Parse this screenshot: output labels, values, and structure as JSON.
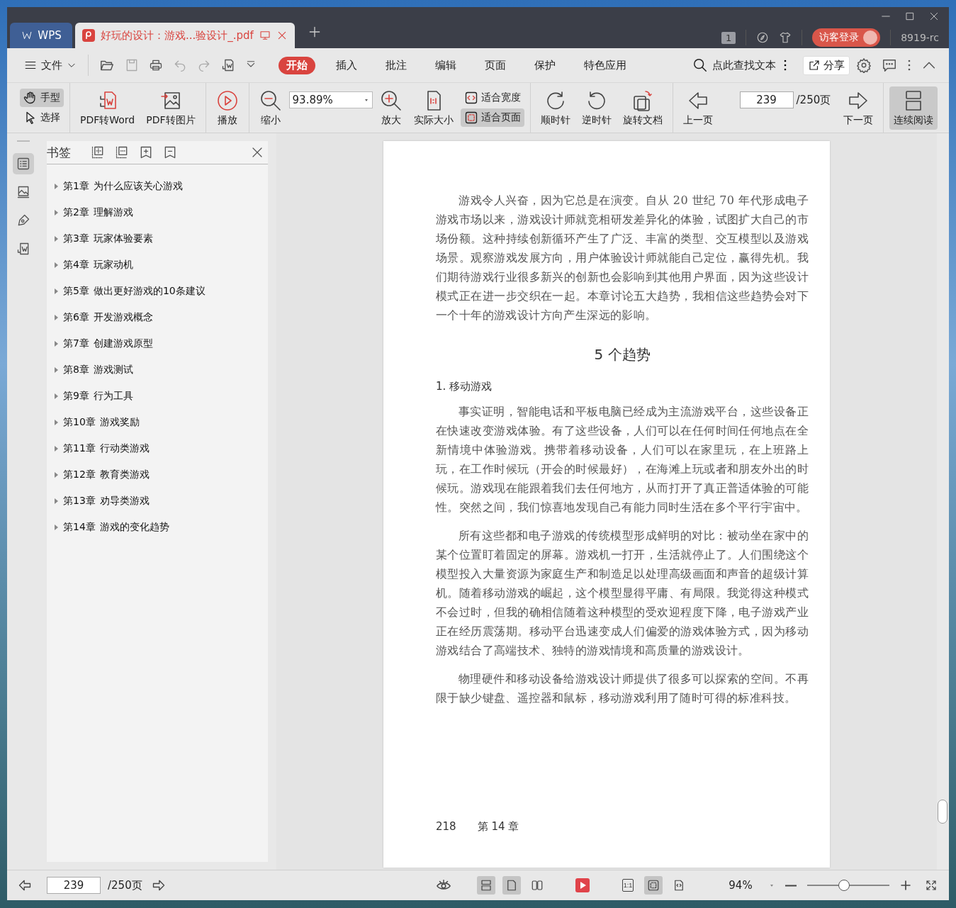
{
  "window": {
    "app_tab": "WPS",
    "doc_tab": "好玩的设计：游戏...验设计_.pdf",
    "badge": "1",
    "login": "访客登录",
    "user": "8919-rc"
  },
  "menu": {
    "file": "文件",
    "tabs": [
      {
        "label": "开始",
        "selected": true
      },
      {
        "label": "插入",
        "selected": false
      },
      {
        "label": "批注",
        "selected": false
      },
      {
        "label": "编辑",
        "selected": false
      },
      {
        "label": "页面",
        "selected": false
      },
      {
        "label": "保护",
        "selected": false
      },
      {
        "label": "特色应用",
        "selected": false
      }
    ],
    "search": "点此查找文本",
    "share": "分享"
  },
  "toolbar": {
    "hand": {
      "label": "手型",
      "selected": true
    },
    "select": {
      "label": "选择",
      "selected": false
    },
    "pdf_to_word": "PDF转Word",
    "pdf_to_image": "PDF转图片",
    "play": "播放",
    "zoom_out": "缩小",
    "zoom": "93.89%",
    "zoom_in": "放大",
    "actual_size": "实际大小",
    "fit_width": {
      "label": "适合宽度",
      "selected": false
    },
    "fit_page": {
      "label": "适合页面",
      "selected": true
    },
    "clockwise": "顺时针",
    "counterclockwise": "逆时针",
    "rotate": "旋转文档",
    "prev": "上一页",
    "page": "239",
    "page_total": "/250页",
    "next": "下一页",
    "continuous": {
      "label": "连续阅读",
      "selected": true
    }
  },
  "sidebar": {
    "title": "书签",
    "items": [
      {
        "number": "第1章",
        "title": "为什么应该关心游戏",
        "expanded": false
      },
      {
        "number": "第2章",
        "title": "理解游戏",
        "expanded": false
      },
      {
        "number": "第3章",
        "title": "玩家体验要素",
        "expanded": false
      },
      {
        "number": "第4章",
        "title": "玩家动机",
        "expanded": false
      },
      {
        "number": "第5章",
        "title": "做出更好游戏的10条建议",
        "expanded": false
      },
      {
        "number": "第6章",
        "title": "开发游戏概念",
        "expanded": false
      },
      {
        "number": "第7章",
        "title": "创建游戏原型",
        "expanded": false
      },
      {
        "number": "第8章",
        "title": "游戏测试",
        "expanded": false
      },
      {
        "number": "第9章",
        "title": "行为工具",
        "expanded": false
      },
      {
        "number": "第10章",
        "title": "游戏奖励",
        "expanded": false
      },
      {
        "number": "第11章",
        "title": "行动类游戏",
        "expanded": false
      },
      {
        "number": "第12章",
        "title": "教育类游戏",
        "expanded": false
      },
      {
        "number": "第13章",
        "title": "劝导类游戏",
        "expanded": false
      },
      {
        "number": "第14章",
        "title": "游戏的变化趋势",
        "expanded": false
      }
    ]
  },
  "document": {
    "blocks": [
      {
        "kind": "paragraph",
        "text": "游戏令人兴奋，因为它总是在演变。自从 20 世纪 70 年代形成电子游戏市场以来，游戏设计师就竞相研发差异化的体验，试图扩大自己的市场份额。这种持续创新循环产生了广泛、丰富的类型、交互模型以及游戏场景。观察游戏发展方向，用户体验设计师就能自己定位，赢得先机。我们期待游戏行业很多新兴的创新也会影响到其他用户界面，因为这些设计模式正在进一步交织在一起。本章讨论五大趋势，我相信这些趋势会对下一个十年的游戏设计方向产生深远的影响。"
      },
      {
        "kind": "heading",
        "text": "5 个趋势"
      },
      {
        "kind": "subheading",
        "text": "1. 移动游戏"
      },
      {
        "kind": "paragraph",
        "text": "事实证明，智能电话和平板电脑已经成为主流游戏平台，这些设备正在快速改变游戏体验。有了这些设备，人们可以在任何时间任何地点在全新情境中体验游戏。携带着移动设备，人们可以在家里玩，在上班路上玩，在工作时候玩（开会的时候最好），在海滩上玩或者和朋友外出的时候玩。游戏现在能跟着我们去任何地方，从而打开了真正普适体验的可能性。突然之间，我们惊喜地发现自己有能力同时生活在多个平行宇宙中。"
      },
      {
        "kind": "paragraph",
        "text": "所有这些都和电子游戏的传统模型形成鲜明的对比：被动坐在家中的某个位置盯着固定的屏幕。游戏机一打开，生活就停止了。人们围绕这个模型投入大量资源为家庭生产和制造足以处理高级画面和声音的超级计算机。随着移动游戏的崛起，这个模型显得平庸、有局限。我觉得这种模式不会过时，但我的确相信随着这种模型的受欢迎程度下降，电子游戏产业正在经历震荡期。移动平台迅速变成人们偏爱的游戏体验方式，因为移动游戏结合了高端技术、独特的游戏情境和高质量的游戏设计。"
      },
      {
        "kind": "paragraph",
        "text": "物理硬件和移动设备给游戏设计师提供了很多可以探索的空间。不再限于缺少键盘、遥控器和鼠标，移动游戏利用了随时可得的标准科技。"
      }
    ],
    "footer": {
      "page": "218",
      "chapter": "第 14 章"
    }
  },
  "status_bar": {
    "page": "239",
    "page_total": "/250页",
    "view_modes": [
      {
        "selected": true
      },
      {
        "selected": true
      },
      {
        "selected": false
      }
    ],
    "fit_modes": [
      {
        "label": "1:1",
        "selected": false
      },
      {
        "selected": true
      },
      {
        "selected": false
      }
    ],
    "zoom": "94%",
    "level": 0.45
  }
}
